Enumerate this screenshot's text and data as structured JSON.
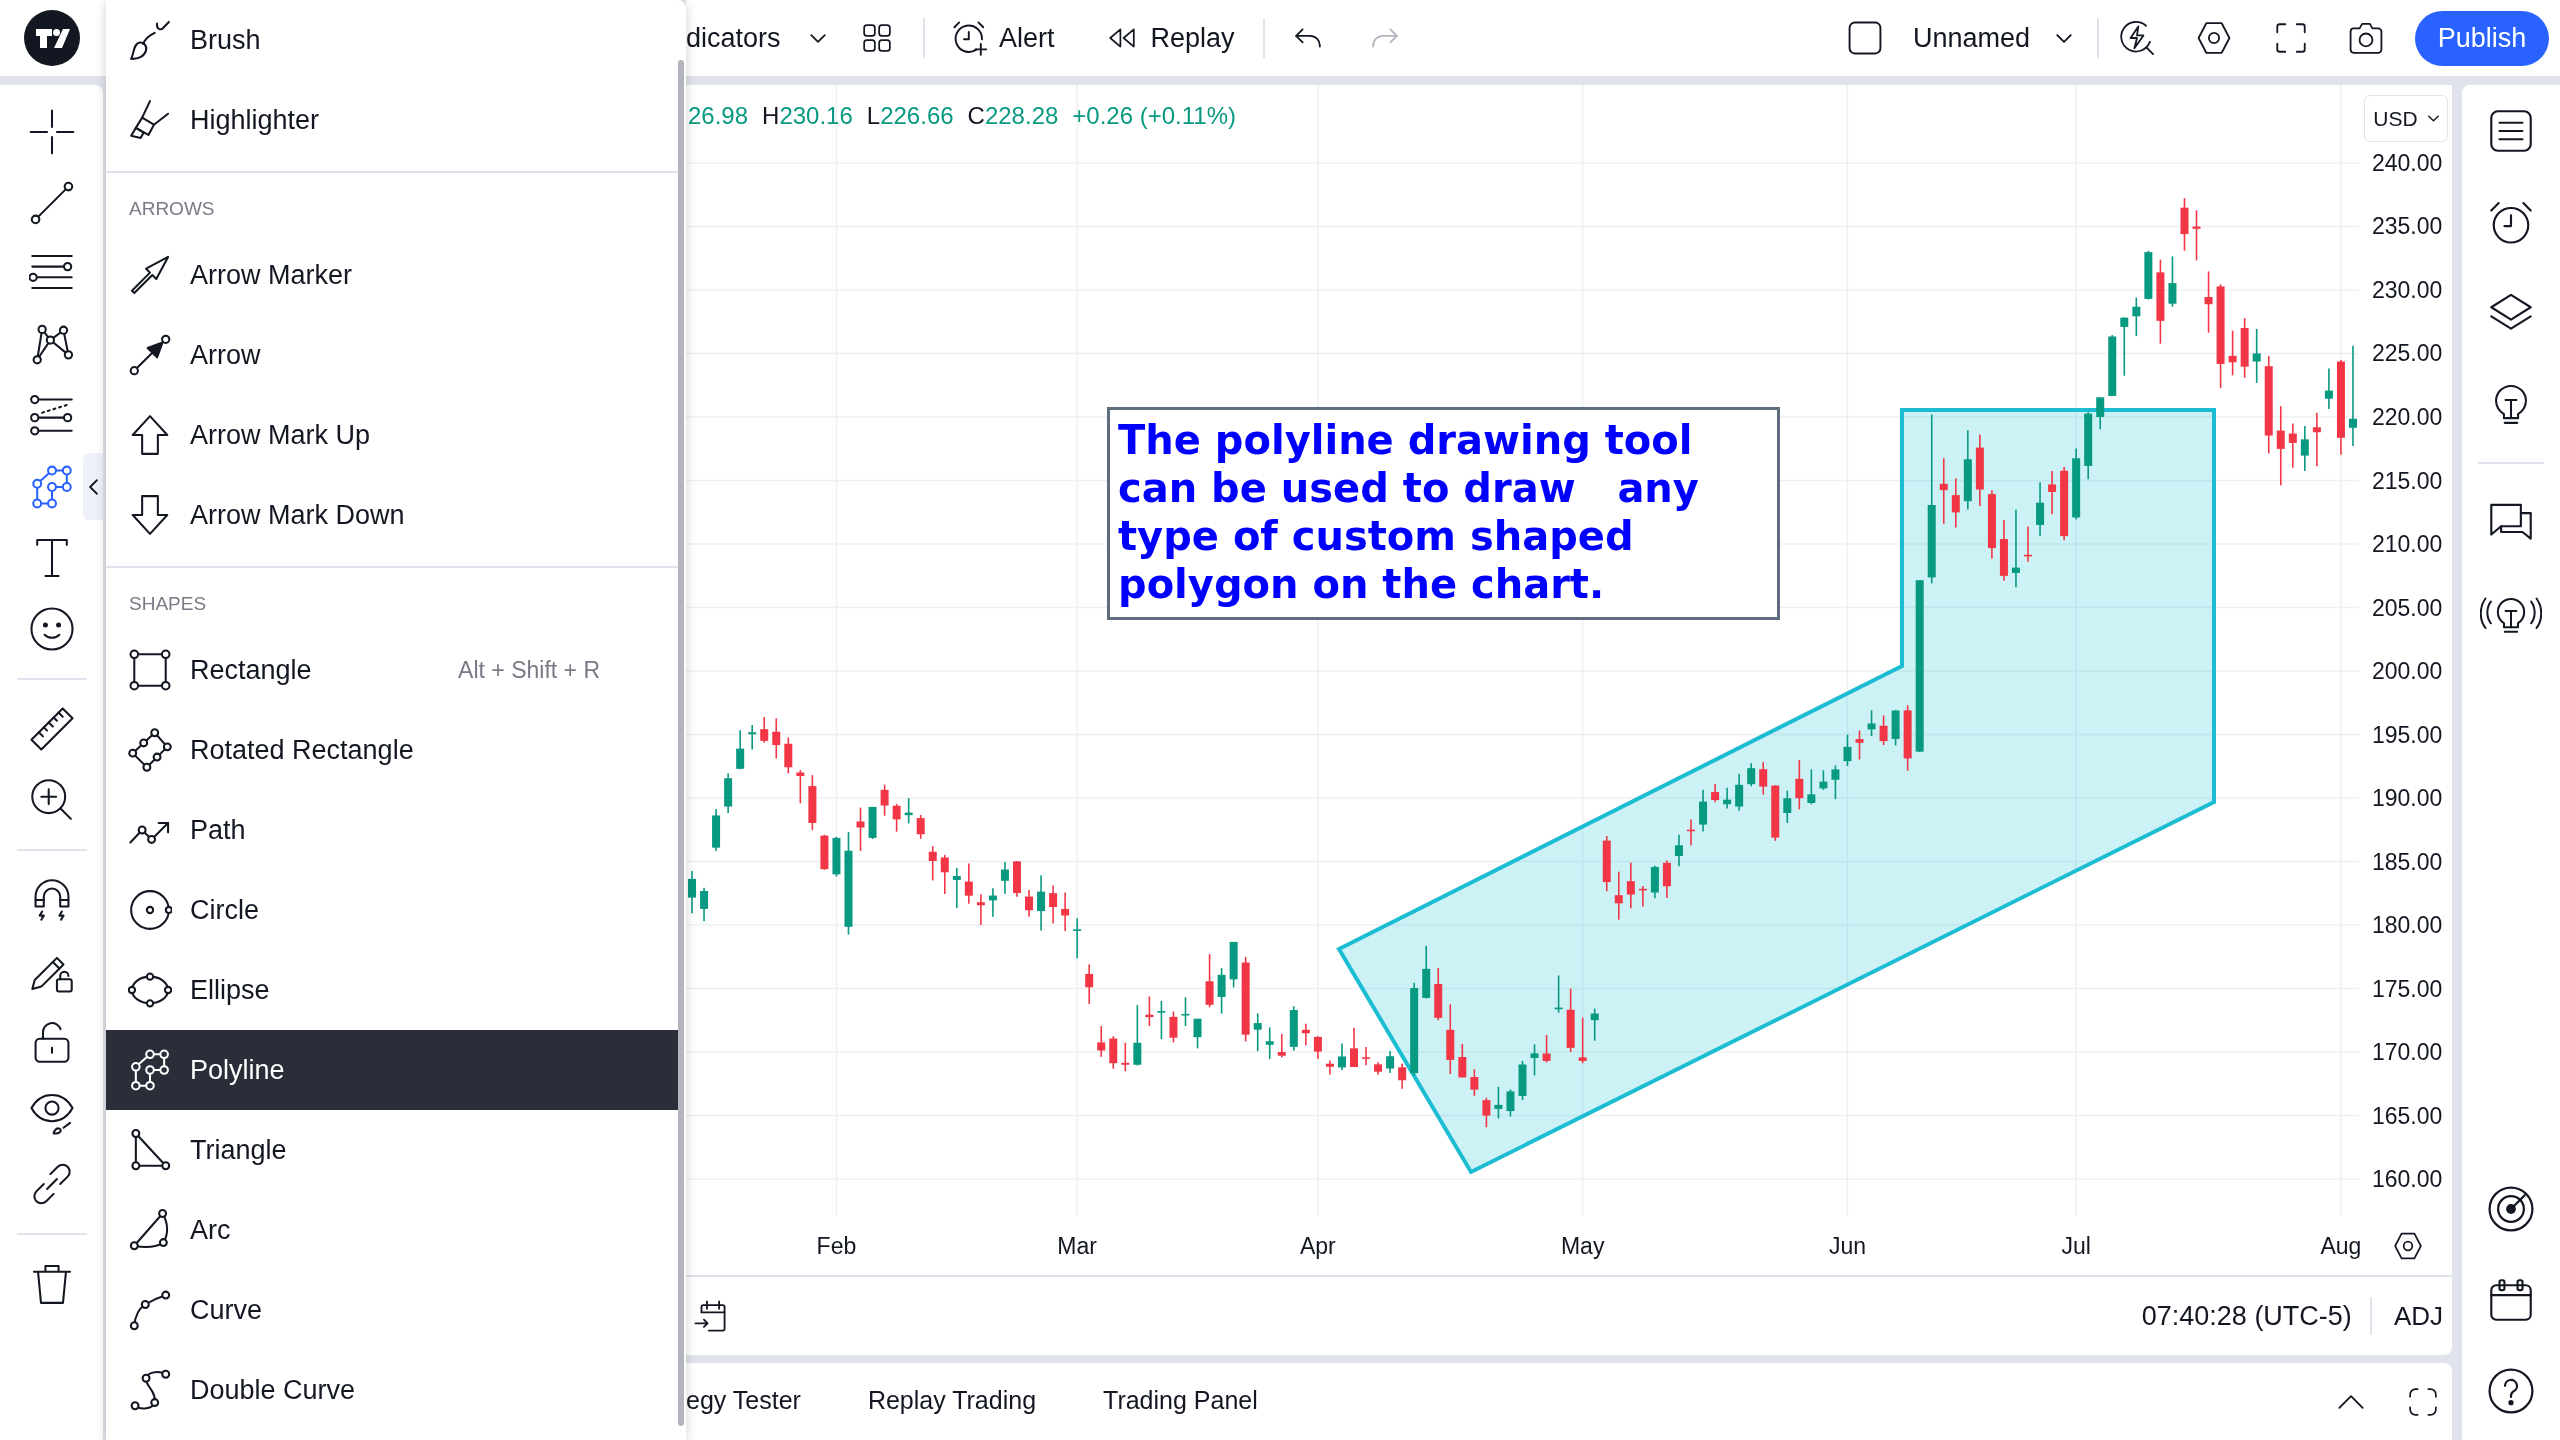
{
  "left_toolbar": {
    "tools": [
      {
        "selected": false
      },
      {
        "selected": false
      },
      {
        "selected": false
      },
      {
        "selected": false
      },
      {
        "selected": false
      },
      {
        "selected": true
      },
      {
        "selected": false
      },
      {
        "selected": false
      },
      {
        "selected": false
      },
      {
        "selected": false
      },
      {
        "selected": false
      },
      {
        "selected": false
      },
      {
        "selected": false
      },
      {
        "selected": false
      },
      {
        "selected": false
      },
      {
        "selected": false
      }
    ]
  },
  "drawing_menu": {
    "sections": [
      {
        "items": [
          {
            "label": "Brush",
            "selected": false
          },
          {
            "label": "Highlighter",
            "selected": false
          }
        ]
      },
      {
        "title": "ARROWS",
        "items": [
          {
            "label": "Arrow Marker",
            "selected": false
          },
          {
            "label": "Arrow",
            "selected": false
          },
          {
            "label": "Arrow Mark Up",
            "selected": false
          },
          {
            "label": "Arrow Mark Down",
            "selected": false
          }
        ]
      },
      {
        "title": "SHAPES",
        "items": [
          {
            "label": "Rectangle",
            "shortcut": "Alt + Shift + R",
            "selected": false
          },
          {
            "label": "Rotated Rectangle",
            "selected": false
          },
          {
            "label": "Path",
            "selected": false
          },
          {
            "label": "Circle",
            "selected": false
          },
          {
            "label": "Ellipse",
            "selected": false
          },
          {
            "label": "Polyline",
            "selected": true
          },
          {
            "label": "Triangle",
            "selected": false
          },
          {
            "label": "Arc",
            "selected": false
          },
          {
            "label": "Curve",
            "selected": false
          },
          {
            "label": "Double Curve",
            "selected": false
          }
        ]
      }
    ]
  },
  "top_bar": {
    "indicators_label": "dicators",
    "alert_label": "Alert",
    "replay_label": "Replay",
    "undo": {
      "disabled": false
    },
    "redo": {
      "disabled": true
    },
    "layout_name": "Unnamed",
    "publish_label": "Publish"
  },
  "chart": {
    "legend": [
      {
        "value": "26.98"
      },
      {
        "label": "H",
        "value": "230.16"
      },
      {
        "label": "L",
        "value": "226.66"
      },
      {
        "label": "C",
        "value": "228.28"
      },
      {
        "value": "+0.26 (+0.11%)"
      }
    ],
    "currency": "USD",
    "chart_data": [
      {
        "type": "candlestick",
        "grid": true,
        "ylim": [
          157.09,
          246.14
        ],
        "yticks": [
          {
            "value": 240,
            "label": "240.00"
          },
          {
            "value": 235,
            "label": "235.00"
          },
          {
            "value": 230,
            "label": "230.00"
          },
          {
            "value": 225,
            "label": "225.00"
          },
          {
            "value": 220,
            "label": "220.00"
          },
          {
            "value": 215,
            "label": "215.00"
          },
          {
            "value": 210,
            "label": "210.00"
          },
          {
            "value": 205,
            "label": "205.00"
          },
          {
            "value": 200,
            "label": "200.00"
          },
          {
            "value": 195,
            "label": "195.00"
          },
          {
            "value": 190,
            "label": "190.00"
          },
          {
            "value": 185,
            "label": "185.00"
          },
          {
            "value": 180,
            "label": "180.00"
          },
          {
            "value": 175,
            "label": "175.00"
          },
          {
            "value": 170,
            "label": "170.00"
          },
          {
            "value": 165,
            "label": "165.00"
          },
          {
            "value": 160,
            "label": "160.00"
          }
        ],
        "categories": [
          null,
          null,
          null,
          null,
          null,
          null,
          null,
          null,
          null,
          null,
          null,
          null,
          "Feb",
          null,
          null,
          null,
          null,
          null,
          null,
          null,
          null,
          null,
          null,
          null,
          null,
          null,
          null,
          null,
          null,
          null,
          null,
          null,
          "Mar",
          null,
          null,
          null,
          null,
          null,
          null,
          null,
          null,
          null,
          null,
          null,
          null,
          null,
          null,
          null,
          null,
          null,
          null,
          null,
          "Apr",
          null,
          null,
          null,
          null,
          null,
          null,
          null,
          null,
          null,
          null,
          null,
          null,
          null,
          null,
          null,
          null,
          null,
          null,
          null,
          null,
          null,
          "May",
          null,
          null,
          null,
          null,
          null,
          null,
          null,
          null,
          null,
          null,
          null,
          null,
          null,
          null,
          null,
          null,
          null,
          null,
          null,
          null,
          null,
          "Jun",
          null,
          null,
          null,
          null,
          null,
          null,
          null,
          null,
          null,
          null,
          null,
          null,
          null,
          null,
          null,
          null,
          null,
          null,
          "Jul",
          null,
          null,
          null,
          null,
          null,
          null,
          null,
          null,
          null,
          null,
          null,
          null,
          null,
          null,
          null,
          null,
          null,
          null,
          null,
          null,
          null,
          "Aug",
          null
        ],
        "ohlc": [
          [
            182.16,
            184.26,
            180.93,
            183.63
          ],
          [
            181.27,
            182.93,
            180.3,
            182.68
          ],
          [
            186.09,
            189.14,
            185.83,
            188.63
          ],
          [
            189.33,
            191.95,
            188.82,
            191.56
          ],
          [
            192.3,
            195.33,
            192.26,
            193.89
          ],
          [
            195.02,
            195.75,
            193.83,
            195.18
          ],
          [
            195.42,
            196.38,
            194.34,
            194.5
          ],
          [
            195.22,
            196.27,
            193.11,
            194.17
          ],
          [
            194.27,
            194.76,
            191.94,
            192.42
          ],
          [
            192.01,
            192.2,
            189.58,
            191.73
          ],
          [
            190.94,
            191.8,
            187.47,
            188.04
          ],
          [
            187.04,
            187.1,
            184.35,
            184.4
          ],
          [
            183.99,
            186.95,
            183.82,
            186.86
          ],
          [
            179.86,
            187.33,
            179.25,
            185.85
          ],
          [
            188.15,
            189.25,
            185.84,
            187.68
          ],
          [
            186.86,
            189.31,
            186.77,
            189.3
          ],
          [
            190.64,
            191.05,
            188.61,
            189.41
          ],
          [
            189.39,
            189.54,
            187.35,
            188.32
          ],
          [
            188.65,
            189.99,
            188.0,
            188.85
          ],
          [
            188.42,
            188.67,
            186.79,
            187.15
          ],
          [
            185.77,
            186.21,
            183.51,
            185.04
          ],
          [
            185.32,
            185.53,
            182.44,
            184.15
          ],
          [
            183.55,
            184.49,
            181.35,
            183.86
          ],
          [
            183.42,
            184.85,
            181.67,
            182.31
          ],
          [
            181.79,
            182.43,
            180.0,
            181.56
          ],
          [
            181.94,
            182.89,
            180.66,
            182.32
          ],
          [
            183.48,
            184.96,
            182.46,
            184.37
          ],
          [
            185.01,
            185.04,
            182.23,
            182.52
          ],
          [
            182.24,
            182.76,
            180.65,
            181.16
          ],
          [
            181.1,
            183.92,
            179.56,
            182.63
          ],
          [
            182.51,
            183.12,
            180.13,
            181.42
          ],
          [
            181.27,
            182.57,
            179.53,
            180.75
          ],
          [
            179.55,
            180.53,
            177.38,
            179.66
          ],
          [
            176.15,
            176.9,
            173.79,
            175.1
          ],
          [
            170.76,
            172.04,
            169.62,
            170.12
          ],
          [
            171.06,
            171.24,
            168.68,
            169.12
          ],
          [
            169.15,
            170.73,
            168.49,
            169.0
          ],
          [
            169.0,
            173.7,
            168.94,
            170.73
          ],
          [
            172.94,
            174.38,
            172.05,
            172.75
          ],
          [
            173.15,
            174.03,
            171.01,
            173.23
          ],
          [
            172.77,
            173.19,
            170.76,
            171.13
          ],
          [
            172.91,
            174.31,
            172.05,
            173.0
          ],
          [
            171.17,
            172.62,
            170.29,
            172.62
          ],
          [
            175.57,
            177.71,
            173.52,
            173.72
          ],
          [
            174.34,
            176.61,
            173.03,
            176.08
          ],
          [
            175.72,
            178.67,
            175.09,
            178.67
          ],
          [
            177.05,
            177.49,
            170.84,
            171.37
          ],
          [
            171.76,
            173.05,
            170.06,
            172.28
          ],
          [
            170.57,
            171.94,
            169.45,
            170.85
          ],
          [
            170.0,
            171.42,
            169.58,
            169.71
          ],
          [
            170.41,
            173.6,
            170.11,
            173.31
          ],
          [
            171.75,
            172.23,
            170.51,
            171.48
          ],
          [
            171.19,
            171.25,
            169.48,
            170.03
          ],
          [
            169.08,
            169.34,
            168.23,
            168.84
          ],
          [
            168.79,
            170.68,
            168.58,
            169.65
          ],
          [
            170.29,
            171.92,
            168.82,
            168.82
          ],
          [
            169.59,
            170.39,
            168.95,
            169.58
          ],
          [
            169.03,
            169.2,
            168.24,
            168.45
          ],
          [
            168.7,
            170.08,
            168.35,
            169.67
          ],
          [
            168.8,
            169.09,
            167.11,
            167.78
          ],
          [
            168.34,
            175.46,
            168.16,
            175.04
          ],
          [
            174.26,
            178.36,
            174.21,
            176.55
          ],
          [
            175.36,
            176.63,
            172.5,
            172.69
          ],
          [
            171.75,
            173.76,
            168.27,
            169.38
          ],
          [
            169.61,
            170.65,
            168.0,
            168.0
          ],
          [
            168.03,
            168.64,
            166.55,
            167.04
          ],
          [
            166.21,
            166.4,
            164.08,
            165.0
          ],
          [
            165.52,
            167.26,
            164.77,
            165.84
          ],
          [
            165.35,
            167.05,
            164.92,
            166.9
          ],
          [
            166.54,
            169.3,
            166.21,
            169.02
          ],
          [
            169.53,
            170.61,
            168.15,
            169.89
          ],
          [
            169.88,
            171.34,
            169.18,
            169.3
          ],
          [
            173.37,
            176.03,
            173.1,
            173.5
          ],
          [
            173.33,
            174.99,
            170.0,
            170.33
          ],
          [
            169.58,
            172.71,
            169.11,
            169.3
          ],
          [
            172.51,
            173.42,
            170.89,
            173.03
          ],
          [
            186.65,
            187.0,
            182.66,
            183.38
          ],
          [
            182.35,
            184.2,
            180.42,
            181.71
          ],
          [
            183.45,
            184.9,
            181.32,
            182.4
          ],
          [
            182.85,
            183.07,
            181.45,
            182.74
          ],
          [
            182.56,
            184.66,
            182.11,
            184.57
          ],
          [
            184.9,
            185.09,
            182.13,
            183.05
          ],
          [
            185.44,
            187.1,
            184.62,
            186.28
          ],
          [
            187.51,
            188.3,
            186.29,
            187.43
          ],
          [
            187.91,
            190.65,
            187.37,
            189.72
          ],
          [
            190.47,
            191.1,
            189.66,
            189.84
          ],
          [
            189.51,
            190.81,
            189.18,
            189.87
          ],
          [
            189.33,
            191.92,
            189.01,
            191.04
          ],
          [
            191.09,
            192.73,
            190.92,
            192.35
          ],
          [
            192.27,
            192.82,
            190.27,
            190.9
          ],
          [
            190.98,
            191.0,
            186.63,
            186.88
          ],
          [
            188.82,
            190.58,
            188.04,
            189.98
          ],
          [
            191.51,
            193.0,
            189.1,
            189.99
          ],
          [
            189.61,
            192.25,
            189.51,
            190.29
          ],
          [
            190.76,
            192.18,
            190.63,
            191.29
          ],
          [
            191.44,
            192.57,
            189.91,
            192.25
          ],
          [
            192.9,
            194.99,
            192.52,
            194.03
          ],
          [
            194.64,
            195.32,
            193.03,
            194.35
          ],
          [
            195.4,
            196.9,
            194.87,
            195.87
          ],
          [
            195.69,
            196.5,
            194.17,
            194.48
          ],
          [
            194.65,
            196.94,
            194.14,
            196.89
          ],
          [
            196.9,
            197.3,
            192.15,
            193.12
          ],
          [
            193.65,
            207.16,
            193.63,
            207.15
          ],
          [
            207.37,
            220.2,
            206.9,
            213.07
          ],
          [
            214.74,
            216.75,
            211.6,
            214.24
          ],
          [
            213.85,
            215.17,
            211.3,
            212.49
          ],
          [
            213.37,
            218.95,
            212.72,
            216.67
          ],
          [
            217.59,
            218.63,
            213.0,
            214.29
          ],
          [
            213.93,
            214.24,
            208.85,
            209.68
          ],
          [
            210.39,
            211.89,
            207.11,
            207.49
          ],
          [
            207.72,
            212.7,
            206.59,
            208.14
          ],
          [
            209.15,
            211.38,
            208.61,
            209.07
          ],
          [
            211.5,
            214.86,
            210.64,
            213.25
          ],
          [
            214.69,
            215.74,
            212.35,
            214.1
          ],
          [
            215.77,
            216.07,
            210.3,
            210.62
          ],
          [
            212.09,
            217.51,
            211.92,
            216.75
          ],
          [
            216.15,
            220.38,
            215.1,
            220.27
          ],
          [
            220.0,
            221.55,
            219.03,
            221.55
          ],
          [
            221.65,
            226.45,
            221.65,
            226.34
          ],
          [
            227.09,
            227.85,
            223.25,
            227.82
          ],
          [
            227.93,
            229.4,
            226.37,
            228.68
          ],
          [
            229.3,
            233.08,
            229.25,
            232.98
          ],
          [
            231.39,
            232.39,
            225.77,
            227.57
          ],
          [
            228.92,
            232.64,
            228.68,
            230.54
          ],
          [
            236.48,
            237.23,
            233.09,
            234.4
          ],
          [
            235.0,
            236.27,
            232.33,
            234.82
          ],
          [
            229.45,
            231.46,
            226.64,
            228.88
          ],
          [
            230.28,
            230.44,
            222.27,
            224.18
          ],
          [
            224.82,
            226.8,
            223.28,
            224.31
          ],
          [
            227.01,
            227.78,
            223.09,
            223.96
          ],
          [
            224.37,
            226.94,
            222.68,
            225.01
          ],
          [
            224.0,
            224.8,
            217.13,
            218.54
          ],
          [
            218.93,
            220.85,
            214.62,
            217.49
          ],
          [
            218.7,
            219.49,
            216.01,
            217.96
          ],
          [
            216.96,
            219.3,
            215.75,
            218.24
          ],
          [
            219.19,
            220.33,
            216.12,
            218.8
          ],
          [
            221.44,
            223.82,
            220.63,
            222.08
          ],
          [
            224.37,
            224.48,
            217.02,
            218.36
          ],
          [
            219.15,
            225.6,
            217.71,
            219.86
          ]
        ],
        "annotations": [
          "The polyline drawing tool\ncan be used to draw   any\ntype of custom shaped\npolygon on the chart."
        ]
      }
    ],
    "time": "07:40:28 (UTC-5)",
    "adj_label": "ADJ"
  },
  "bottom_panel": {
    "tabs": [
      {
        "label": "egy Tester",
        "selected": false
      },
      {
        "label": "Replay Trading",
        "selected": false
      },
      {
        "label": "Trading Panel",
        "selected": false
      }
    ]
  }
}
